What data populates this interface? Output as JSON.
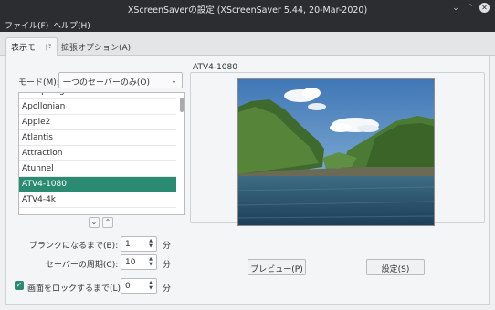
{
  "window": {
    "title": "XScreenSaverの設定 (XScreenSaver 5.44, 20-Mar-2020)",
    "controls": {
      "minimize": "⌄",
      "maximize": "⌃",
      "close": "✕"
    }
  },
  "menu": {
    "file": "ファイル(F)",
    "help": "ヘルプ(H)"
  },
  "tabs": {
    "display_mode": "表示モード",
    "advanced": "拡張オプション(A)"
  },
  "mode": {
    "label": "モード(M):",
    "value": "一つのセーバーのみ(O)",
    "arrow": "⌄"
  },
  "savers": [
    "AntSpotlight",
    "Apollonian",
    "Apple2",
    "Atlantis",
    "Attraction",
    "Atunnel",
    "ATV4-1080",
    "ATV4-4k"
  ],
  "selected_saver_index": 6,
  "list_nav": {
    "down": "⌄",
    "up": "⌃"
  },
  "timing": {
    "blank_label": "ブランクになるまで(B):",
    "blank_value": "1",
    "blank_unit": "分",
    "cycle_label": "セーバーの周期(C):",
    "cycle_value": "10",
    "cycle_unit": "分",
    "lock_label": "画面をロックするまで(L):",
    "lock_value": "0",
    "lock_unit": "分",
    "lock_checked": true,
    "spin_up": "▲",
    "spin_down": "▼",
    "check_mark": "✓"
  },
  "preview": {
    "title": "ATV4-1080",
    "preview_button": "プレビュー(P)",
    "settings_button": "設定(S)"
  },
  "colors": {
    "accent": "#2b8a72",
    "titlebar": "#2b2d30"
  }
}
